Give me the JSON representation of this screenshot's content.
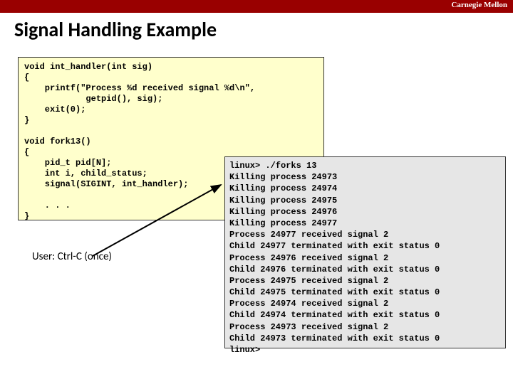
{
  "header": {
    "institution": "Carnegie Mellon"
  },
  "title": "Signal Handling Example",
  "code": "void int_handler(int sig)\n{\n    printf(\"Process %d received signal %d\\n\",\n            getpid(), sig);\n    exit(0);\n}\n\nvoid fork13()\n{\n    pid_t pid[N];\n    int i, child_status;\n    signal(SIGINT, int_handler);\n\n    . . .\n}",
  "note": "User: Ctrl-C (once)",
  "output": "linux> ./forks 13\nKilling process 24973\nKilling process 24974\nKilling process 24975\nKilling process 24976\nKilling process 24977\nProcess 24977 received signal 2\nChild 24977 terminated with exit status 0\nProcess 24976 received signal 2\nChild 24976 terminated with exit status 0\nProcess 24975 received signal 2\nChild 24975 terminated with exit status 0\nProcess 24974 received signal 2\nChild 24974 terminated with exit status 0\nProcess 24973 received signal 2\nChild 24973 terminated with exit status 0\nlinux>"
}
